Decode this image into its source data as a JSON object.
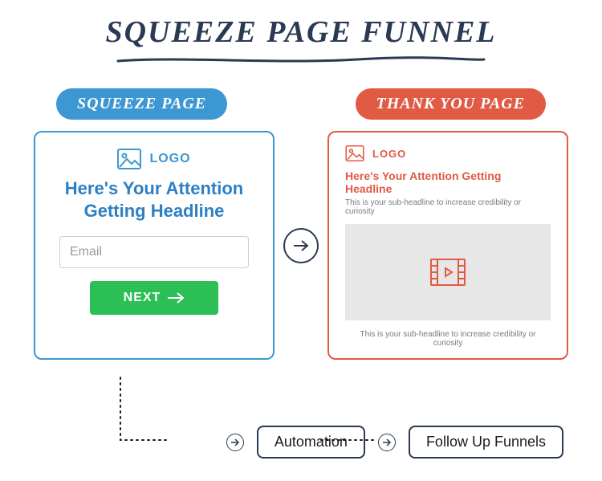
{
  "title": "SQUEEZE PAGE FUNNEL",
  "labels": {
    "squeeze_pill": "SQUEEZE PAGE",
    "thankyou_pill": "THANK YOU PAGE"
  },
  "squeeze_panel": {
    "logo_text": "LOGO",
    "headline": "Here's Your Attention Getting Headline",
    "email_placeholder": "Email",
    "next_label": "NEXT"
  },
  "thankyou_panel": {
    "logo_text": "LOGO",
    "headline": "Here's Your Attention Getting Headline",
    "sub1": "This is your sub-headline to increase credibility or curiosity",
    "sub2": "This is your sub-headline to increase credibility or curiosity"
  },
  "flow": {
    "automation": "Automation",
    "followup": "Follow Up Funnels"
  },
  "colors": {
    "blue": "#3d97d3",
    "red": "#e05a44",
    "dark": "#2b3a53",
    "green": "#2bbf55"
  }
}
